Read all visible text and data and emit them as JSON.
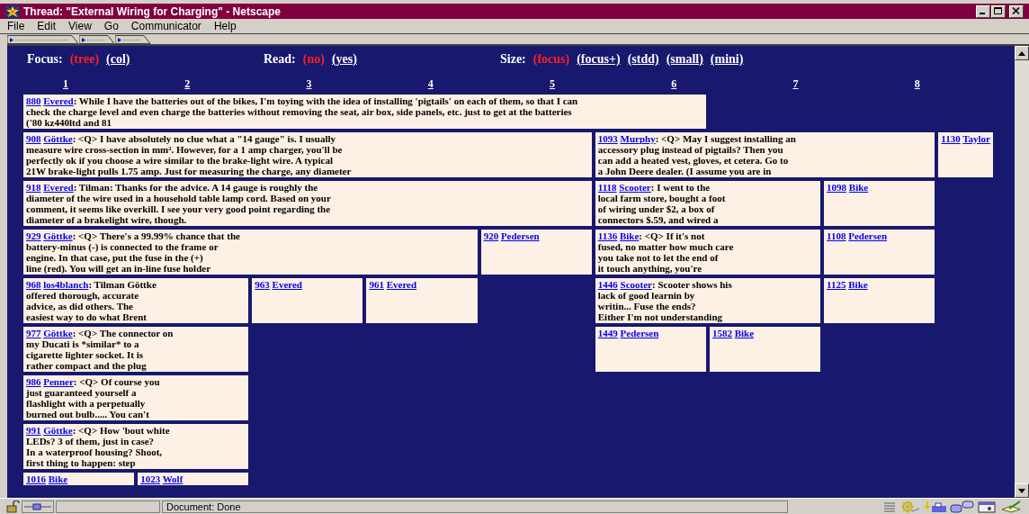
{
  "window": {
    "title": "Thread: \"External Wiring for Charging\" - Netscape"
  },
  "menu": [
    "File",
    "Edit",
    "View",
    "Go",
    "Communicator",
    "Help"
  ],
  "controls": [
    {
      "label": "Focus:",
      "options": [
        {
          "label": "(tree)",
          "selected": true
        },
        {
          "label": "(col)",
          "selected": false
        }
      ]
    },
    {
      "label": "Read:",
      "options": [
        {
          "label": "(no)",
          "selected": true
        },
        {
          "label": "(yes)",
          "selected": false
        }
      ]
    },
    {
      "label": "Size:",
      "options": [
        {
          "label": "(focus)",
          "selected": true
        },
        {
          "label": "(focus+)",
          "selected": false
        },
        {
          "label": "(stdd)",
          "selected": false
        },
        {
          "label": "(small)",
          "selected": false
        },
        {
          "label": "(mini)",
          "selected": false
        }
      ]
    }
  ],
  "column_headers": [
    "1",
    "2",
    "3",
    "4",
    "5",
    "6",
    "7",
    "8"
  ],
  "thread": {
    "number": "880",
    "author": "Evered",
    "lines": [
      ": While I have the batteries out of the bikes, I'm toying with the idea of installing 'pigtails' on each of them, so that I can",
      "check the charge level and even charge the batteries without removing the seat, air box, side panels, etc. just to get at the batteries",
      "('80 kz440ltd and 81"
    ],
    "children": [
      {
        "number": "908",
        "author": "Göttke",
        "lines": [
          ": <Q> I have absolutely no clue what a \"14 gauge\" is. I usually",
          "measure wire cross-section in mm². However, for a 1 amp charger, you'll be",
          "perfectly ok if you choose a wire similar to the brake-light wire. A typical",
          "21W brake-light pulls 1.75 amp. Just for measuring the charge, any diameter"
        ],
        "children": [
          {
            "number": "918",
            "author": "Evered",
            "lines": [
              ": Tilman: Thanks for the advice. A 14 gauge is roughly the",
              "diameter of the wire used in a household table lamp cord. Based on your",
              "comment, it seems like overkill. I see your very good point regarding the",
              "diameter of a brakelight wire, though."
            ],
            "children": [
              {
                "number": "929",
                "author": "Göttke",
                "lines": [
                  ": <Q> There's a 99.99% chance that the",
                  "battery-minus (-) is connected to the frame or",
                  "engine. In that case, put the fuse in the (+)",
                  "line (red). You will get an in-line fuse holder"
                ],
                "children": [
                  {
                    "number": "968",
                    "author": "los4blanch",
                    "lines": [
                      ": Tilman Göttke",
                      "offered thorough, accurate",
                      "advice, as did others. The",
                      "easiest way to do what Brent"
                    ],
                    "children": [
                      {
                        "number": "977",
                        "author": "Göttke",
                        "lines": [
                          ": <Q> The connector on",
                          "my Ducati is *similar* to a",
                          "cigarette lighter socket. It is",
                          "rather compact and the plug"
                        ],
                        "children": [
                          {
                            "number": "986",
                            "author": "Penner",
                            "lines": [
                              ": <Q> Of course you",
                              "just guaranteed yourself a",
                              "flashlight with a perpetually",
                              "burned out bulb..... You can't"
                            ],
                            "children": [
                              {
                                "number": "991",
                                "author": "Göttke",
                                "lines": [
                                  ": <Q> How 'bout white",
                                  "LEDs? 3 of them, just in case?",
                                  "In a waterproof housing? Shoot,",
                                  "first thing to happen: step"
                                ],
                                "children": [
                                  {
                                    "number": "1016",
                                    "author": "Bike"
                                  },
                                  {
                                    "number": "1023",
                                    "author": "Wolf"
                                  }
                                ]
                              }
                            ]
                          }
                        ]
                      }
                    ]
                  },
                  {
                    "number": "963",
                    "author": "Evered"
                  },
                  {
                    "number": "961",
                    "author": "Evered"
                  }
                ]
              },
              {
                "number": "920",
                "author": "Pedersen"
              }
            ]
          }
        ]
      },
      {
        "number": "1093",
        "author": "Murphy",
        "lines": [
          ": <Q> May I suggest installing an",
          "accessory plug instead of pigtails? Then you",
          "can add a heated vest, gloves, et cetera. Go to",
          "a John Deere dealer. (I assume you are in"
        ],
        "children": [
          {
            "number": "1118",
            "author": "Scooter",
            "lines": [
              ": I went to the",
              "local farm store, bought a foot",
              "of wiring under $2, a box of",
              "connectors $.59, and wired a"
            ],
            "children": [
              {
                "number": "1136",
                "author": "Bike",
                "lines": [
                  ": <Q> If it's not",
                  "fused, no matter how much care",
                  "you take not to let the end of",
                  "it touch anything, you're"
                ],
                "children": [
                  {
                    "number": "1446",
                    "author": "Scooter",
                    "lines": [
                      ": Scooter shows his",
                      "lack of good learnin by",
                      "writin... Fuse the ends?",
                      "Either I'm not understanding"
                    ],
                    "children": [
                      {
                        "number": "1449",
                        "author": "Pedersen"
                      },
                      {
                        "number": "1582",
                        "author": "Bike"
                      }
                    ]
                  }
                ]
              }
            ]
          },
          {
            "number": "1098",
            "author": "Bike",
            "children": [
              {
                "number": "1108",
                "author": "Pedersen",
                "children": [
                  {
                    "number": "1125",
                    "author": "Bike"
                  }
                ]
              }
            ]
          }
        ]
      },
      {
        "number": "1130",
        "author": "Taylor"
      }
    ]
  },
  "status_bar": {
    "text": "Document: Done"
  }
}
